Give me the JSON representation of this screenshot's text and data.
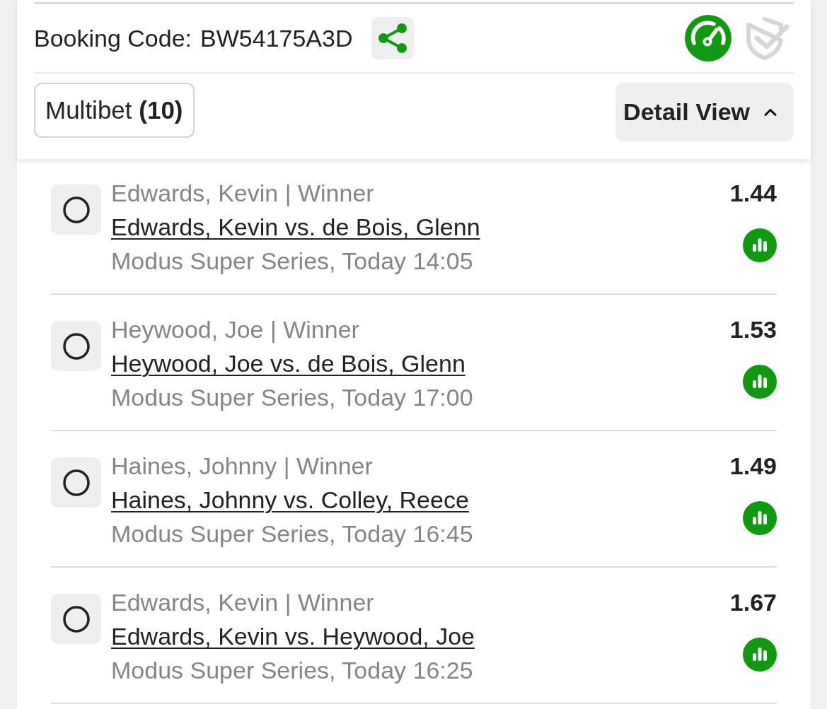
{
  "booking": {
    "label": "Booking Code:",
    "code": "BW54175A3D"
  },
  "status_icons": [
    {
      "kind": "speedometer",
      "active": true
    },
    {
      "kind": "shield-check",
      "active": false
    }
  ],
  "bet_type": {
    "label": "Multibet **(10)**"
  },
  "view_toggle": {
    "label": "Detail View",
    "expanded": true
  },
  "selections": [
    {
      "selected": false,
      "pick": "Edwards, Kevin | Winner",
      "match": "Edwards, Kevin vs. de Bois, Glenn",
      "event": "Modus Super Series, Today 14:05",
      "odds": "1.44"
    },
    {
      "selected": false,
      "pick": "Heywood, Joe | Winner",
      "match": "Heywood, Joe vs. de Bois, Glenn",
      "event": "Modus Super Series, Today 17:00",
      "odds": "1.53"
    },
    {
      "selected": false,
      "pick": "Haines, Johnny | Winner",
      "match": "Haines, Johnny vs. Colley, Reece",
      "event": "Modus Super Series, Today 16:45",
      "odds": "1.49"
    },
    {
      "selected": false,
      "pick": "Edwards, Kevin | Winner",
      "match": "Edwards, Kevin vs. Heywood, Joe",
      "event": "Modus Super Series, Today 16:25",
      "odds": "1.67"
    }
  ]
}
